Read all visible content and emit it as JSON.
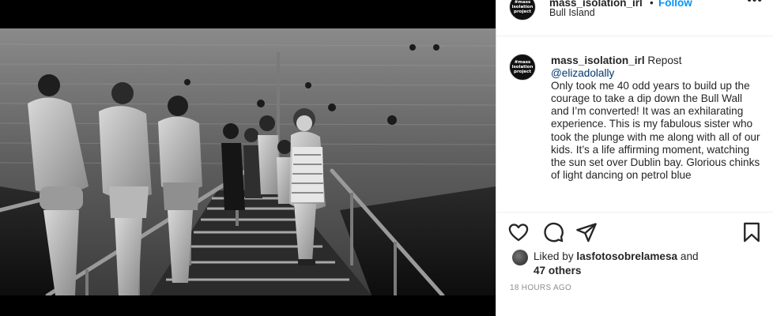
{
  "post": {
    "username": "mass_isolation_irl",
    "separator": "•",
    "follow_label": "Follow",
    "location": "Bull Island",
    "more_icon": "more-options-icon",
    "avatar_text_line1": "#mass",
    "avatar_text_line2": "isolation",
    "avatar_text_line3": "project"
  },
  "caption": {
    "username": "mass_isolation_irl",
    "repost_label": "Repost",
    "mention": "@elizadolally",
    "body": "Only took me 40 odd years to build up the courage to take a dip down the Bull Wall and I’m converted! It was an exhilarating experience. This is my fabulous sister who took the plunge with me along with all of our kids. It’s a life affirming moment, watching the sun set over Dublin bay. Glorious chinks of light dancing on petrol blue"
  },
  "actions": {
    "like_icon": "heart-icon",
    "comment_icon": "comment-icon",
    "share_icon": "share-icon",
    "save_icon": "bookmark-icon"
  },
  "likes": {
    "prefix": "Liked by",
    "liker": "lasfotosobrelamesa",
    "conjunction": "and",
    "others": "47 others"
  },
  "timestamp": "18 HOURS AGO",
  "colors": {
    "link": "#0095f6",
    "text": "#262626",
    "muted": "#8e8e8e",
    "mention": "#00376b"
  }
}
